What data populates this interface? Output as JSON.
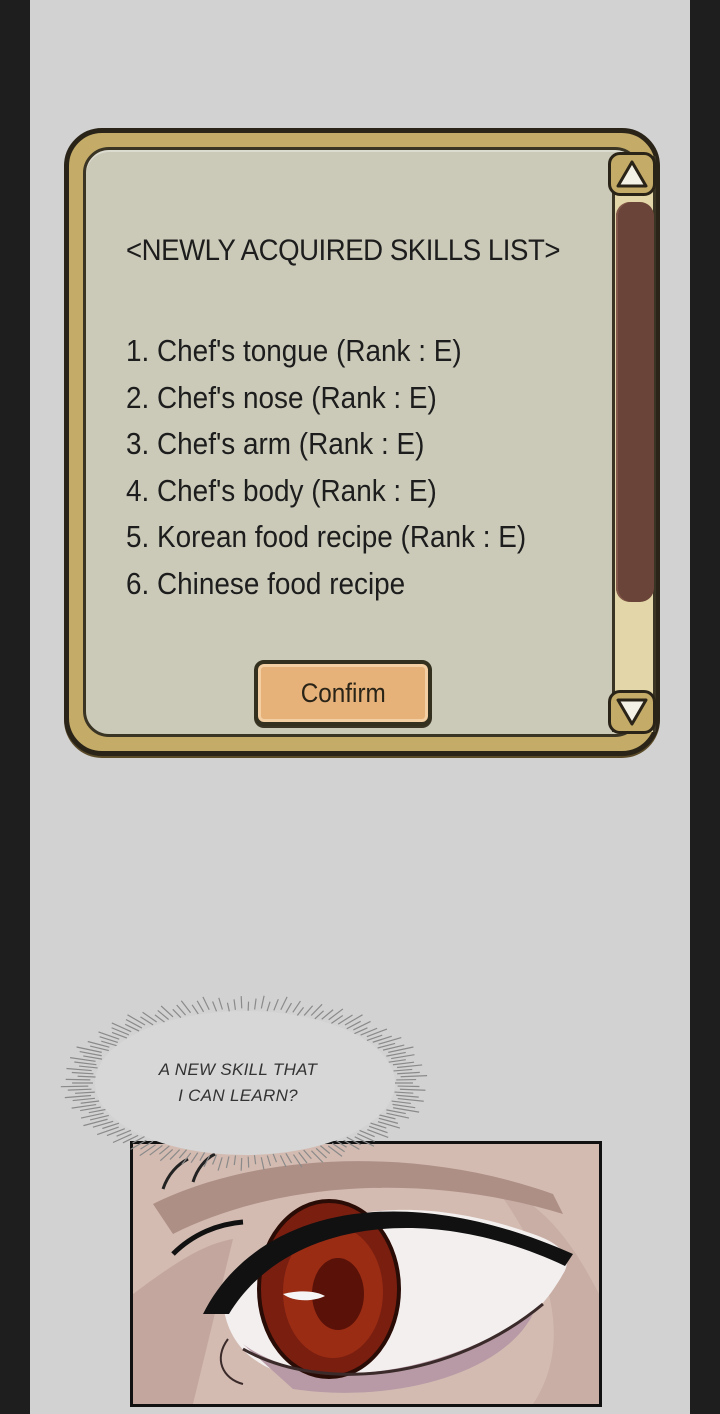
{
  "skills_window": {
    "title": "<NEWLY ACQUIRED SKILLS LIST>",
    "skills": [
      "1. Chef's tongue (Rank : E)",
      "2. Chef's nose (Rank : E)",
      "3. Chef's arm (Rank : E)",
      "4. Chef's body (Rank : E)",
      "5. Korean food recipe (Rank : E)",
      "6. Chinese food recipe"
    ],
    "confirm_label": "Confirm",
    "scroll_up_icon": "triangle-up-icon",
    "scroll_down_icon": "triangle-down-icon"
  },
  "thought_bubble": {
    "lines": [
      "A NEW SKILL THAT",
      "I CAN LEARN?"
    ]
  },
  "colors": {
    "page_background": "#d2d2d2",
    "frame_gold": "#c4ab68",
    "panel_inner": "#cbcab9",
    "scroll_thumb": "#6a4438",
    "confirm_button": "#e6b27a",
    "iris": "#7a1e10"
  }
}
